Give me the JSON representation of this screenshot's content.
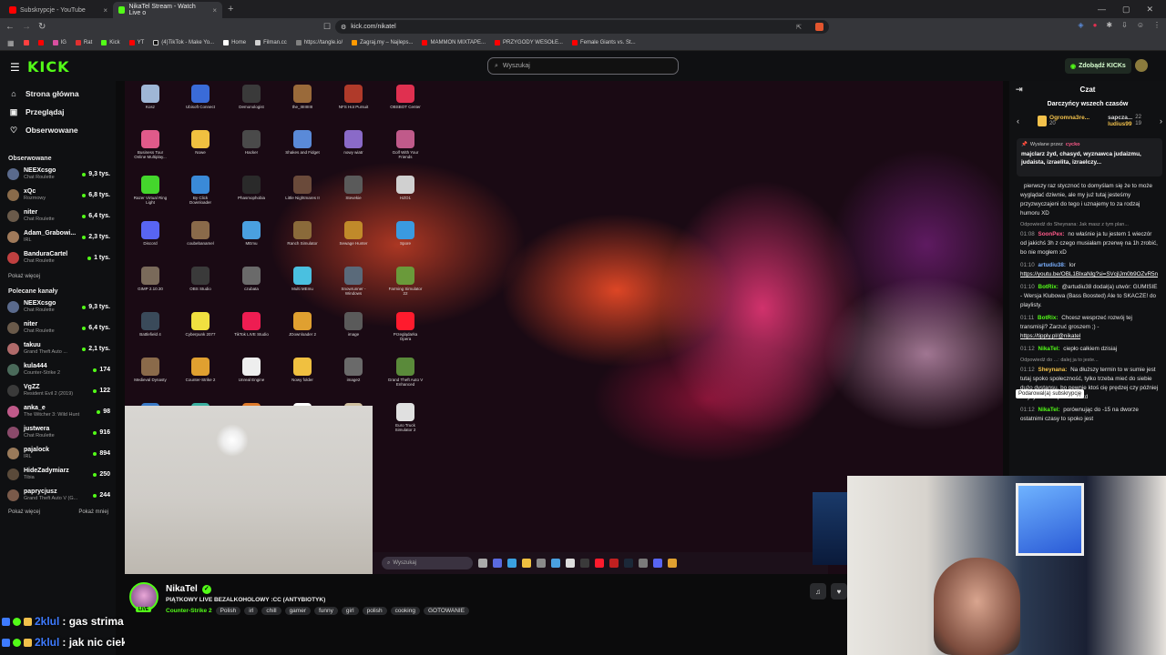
{
  "browser": {
    "tabs": [
      {
        "label": "Subskrypcje - YouTube",
        "color": "#ff0000",
        "active": false
      },
      {
        "label": "NikaTel Stream - Watch Live o",
        "color": "#53fc18",
        "active": true
      }
    ],
    "new_tab": "+",
    "url": "kick.com/nikatel",
    "bookmarks": [
      {
        "label": "",
        "color": "#ff4040"
      },
      {
        "label": "",
        "color": "#ff0000"
      },
      {
        "label": "IG",
        "color": "#d94fa0"
      },
      {
        "label": "Rat",
        "color": "#e03030"
      },
      {
        "label": "Kick",
        "color": "#53fc18"
      },
      {
        "label": "YT",
        "color": "#ff0000"
      },
      {
        "label": "(4)TikTok - Make Yo...",
        "color": "#111111"
      },
      {
        "label": "Home",
        "color": "#ffffff"
      },
      {
        "label": "Filman.cc",
        "color": "#d0d0d0"
      },
      {
        "label": "https://tangle.io/",
        "color": "#808080"
      },
      {
        "label": "Zagraj.my – Najleps...",
        "color": "#ff9900"
      },
      {
        "label": "MAMMON MIXTAPE...",
        "color": "#ff0000"
      },
      {
        "label": "PRZYGODY WESOŁE...",
        "color": "#ff0000"
      },
      {
        "label": "Female Giants vs. St...",
        "color": "#ff0000"
      }
    ]
  },
  "header": {
    "logo": "KICK",
    "search_placeholder": "Wyszukaj",
    "get_kicks": "Zdobądź KICKs"
  },
  "sidebar": {
    "nav": [
      {
        "label": "Strona główna",
        "icon": "home-icon",
        "glyph": "⌂"
      },
      {
        "label": "Przeglądaj",
        "icon": "browse-icon",
        "glyph": "▣"
      },
      {
        "label": "Obserwowane",
        "icon": "heart-icon",
        "glyph": "♡"
      }
    ],
    "followed_title": "Obserwowane",
    "followed": [
      {
        "name": "NEEXcsgo",
        "category": "Chat Roulette",
        "viewers": "9,3 tys.",
        "color": "#5a6a8c"
      },
      {
        "name": "xQc",
        "category": "Rozmowy",
        "viewers": "6,8 tys.",
        "color": "#8a6b4a"
      },
      {
        "name": "niter",
        "category": "Chat Roulette",
        "viewers": "6,4 tys.",
        "color": "#6a5a4a"
      },
      {
        "name": "Adam_Grabowi...",
        "category": "IRL",
        "viewers": "2,3 tys.",
        "color": "#a07a5a"
      },
      {
        "name": "BanduraCartel",
        "category": "Chat Roulette",
        "viewers": "1 tys.",
        "color": "#c04040"
      }
    ],
    "show_more": "Pokaż więcej",
    "recommended_title": "Polecane kanały",
    "recommended": [
      {
        "name": "NEEXcsgo",
        "category": "Chat Roulette",
        "viewers": "9,3 tys.",
        "color": "#5a6a8c"
      },
      {
        "name": "niter",
        "category": "Chat Roulette",
        "viewers": "6,4 tys.",
        "color": "#6a5a4a"
      },
      {
        "name": "takuu",
        "category": "Grand Theft Auto ...",
        "viewers": "2,1 tys.",
        "color": "#b06a6a"
      },
      {
        "name": "kula444",
        "category": "Counter-Strike 2",
        "viewers": "174",
        "color": "#4a6a5a"
      },
      {
        "name": "VgZZ",
        "category": "Resident Evil 2 (2019)",
        "viewers": "122",
        "color": "#3a3a3a"
      },
      {
        "name": "anka_e",
        "category": "The Witcher 3: Wild Hunt",
        "viewers": "98",
        "color": "#c05a8a"
      },
      {
        "name": "justwera",
        "category": "Chat Roulette",
        "viewers": "916",
        "color": "#8a4a6a"
      },
      {
        "name": "pajalock",
        "category": "IRL",
        "viewers": "894",
        "color": "#9a7a5a"
      },
      {
        "name": "HideZadymiarz",
        "category": "Tibia",
        "viewers": "250",
        "color": "#5a4a3a"
      },
      {
        "name": "paprycjusz",
        "category": "Grand Theft Auto V (G...",
        "viewers": "244",
        "color": "#7a5a4a"
      }
    ],
    "show_more2": "Pokaż więcej",
    "show_less": "Pokaż mniej"
  },
  "desktop": {
    "icons": [
      {
        "label": "Kosz",
        "color": "#9fb6d6"
      },
      {
        "label": "Ubisoft Connect",
        "color": "#3a6bd8"
      },
      {
        "label": "Demonologist",
        "color": "#3a3a3a"
      },
      {
        "label": "the_IIIIIIIIIII",
        "color": "#9a6a3a"
      },
      {
        "label": "NFS Hot Pursuit",
        "color": "#b03a2a"
      },
      {
        "label": "OBSBOT Center",
        "color": "#e03050"
      },
      {
        "label": "Business Tour Online Multiplay...",
        "color": "#e05a8a"
      },
      {
        "label": "Nowe",
        "color": "#f0c040"
      },
      {
        "label": "Hacker",
        "color": "#4a4a4a"
      },
      {
        "label": "Shakes and Fidget",
        "color": "#5a8ad8"
      },
      {
        "label": "nowy wiatr",
        "color": "#8a6ac8"
      },
      {
        "label": "Golf With Your Friends",
        "color": "#c05a8a"
      },
      {
        "label": "Razer Virtual Ring Light",
        "color": "#44d62c"
      },
      {
        "label": "By Click Downloader",
        "color": "#3a8ad8"
      },
      {
        "label": "Phasmophobia",
        "color": "#2a2a2a"
      },
      {
        "label": "Little Nightmares II",
        "color": "#6a4a3a"
      },
      {
        "label": "Stevekie",
        "color": "#5a5a5a"
      },
      {
        "label": "HZO1",
        "color": "#d0d0d0"
      },
      {
        "label": "Discord",
        "color": "#5865f2"
      },
      {
        "label": "coubebanamel",
        "color": "#8a6a4a"
      },
      {
        "label": "MEmu",
        "color": "#4aa0e0"
      },
      {
        "label": "Ranch Simulator",
        "color": "#8a6a3a"
      },
      {
        "label": "Sewage Hunter",
        "color": "#c08a2a"
      },
      {
        "label": "Spore",
        "color": "#3a9ae0"
      },
      {
        "label": "GIMP 2.10.30",
        "color": "#7a6a5a"
      },
      {
        "label": "OBS Studio",
        "color": "#3a3a3a"
      },
      {
        "label": "czubata",
        "color": "#6a6a6a"
      },
      {
        "label": "Multi MEmu",
        "color": "#4ac0e0"
      },
      {
        "label": "Snowrunner - Windows",
        "color": "#5a6a7a"
      },
      {
        "label": "Farming Simulator 22",
        "color": "#6a9a3a"
      },
      {
        "label": "Battlefield 4",
        "color": "#3a4a5a"
      },
      {
        "label": "Cyberpunk 2077",
        "color": "#f0e040"
      },
      {
        "label": "TikTok LIVE Studio",
        "color": "#ee1d52"
      },
      {
        "label": "JDownloader 2",
        "color": "#e0a030"
      },
      {
        "label": "image",
        "color": "#5a5a5a"
      },
      {
        "label": "Przeglądarka Opera",
        "color": "#ff1b2d"
      },
      {
        "label": "Medieval Dynasty",
        "color": "#8a6a4a"
      },
      {
        "label": "Counter-Strike 2",
        "color": "#e0a030"
      },
      {
        "label": "Unreal Engine",
        "color": "#eeeeee"
      },
      {
        "label": "Nowy folder",
        "color": "#f0c040"
      },
      {
        "label": "image2",
        "color": "#6a6a6a"
      },
      {
        "label": "Grand Theft Auto V Enhanced",
        "color": "#5a8a3a"
      },
      {
        "label": "Tropico 6 Frontiers of Pandora",
        "color": "#3a7ac8"
      },
      {
        "label": "Sims Kalorgen",
        "color": "#3ab0a0"
      },
      {
        "label": "Kebab Chefs! - Restaurant Si...",
        "color": "#e07a2a"
      },
      {
        "label": "MMSIS",
        "color": "#ffffff"
      },
      {
        "label": "House Flipper 2",
        "color": "#d0c0a0"
      },
      {
        "label": "Euro Truck Simulator 2",
        "color": "#e0e0e0"
      }
    ],
    "taskbar_search": "Wyszukaj"
  },
  "stream": {
    "name": "NikaTel",
    "title": "PIĄTKOWY LIVE BEZALKOHOLOWY :CC (ANTYBIOTYK)",
    "category": "Counter-Strike 2",
    "tags": [
      "Polish",
      "irl",
      "chill",
      "gamer",
      "funny",
      "girl",
      "polish",
      "cooking",
      "GOTOWANIE"
    ],
    "live": "LIVE"
  },
  "overlay_chat": [
    {
      "user": "2klul",
      "text": ": gas strima"
    },
    {
      "user": "2klul",
      "text": ": jak nic ciekawego nie ma"
    }
  ],
  "chat": {
    "title": "Czat",
    "gifters_title": "Darczyńcy wszech czasów",
    "gifters": [
      {
        "name": "Ogromna3re...",
        "count": "20"
      },
      {
        "name": "sapcza...",
        "count": "22"
      },
      {
        "name": "ludius99",
        "count": "19"
      }
    ],
    "pinned_by": "Wysłane przez",
    "pinned_user": "cycko",
    "pinned_text": "majclarz żyd, chasyd, wyznawca judaizmu, judaista, izraelita, izraelczy...",
    "messages": [
      {
        "reply": "",
        "time": "",
        "user": "",
        "color": "#ffffff",
        "text": "pierwszy raz stycznoć to domyślam się że to może wyglądać dziwnie, ale my już tutaj jesteśmy przyzwyczajeni do tego i uznajemy to za rodzaj humoru XD",
        "link": ""
      },
      {
        "reply": "Odpowiedź do Sheynana: Jak masz z tym plan...",
        "time": "01:08",
        "user": "SoonPex:",
        "color": "#ff5a8a",
        "text": "no właśnie ja tu jestem 1 wieczór od jakichś 3h z czego musiałam przerwę na 1h zrobić, bo nie mogłem xD",
        "link": ""
      },
      {
        "reply": "",
        "time": "01:10",
        "user": "artudiu38:",
        "color": "#7ab0ff",
        "text": "lor",
        "link": "https://youtu.be/OBL1BlxaNlg?si=SVcjlJm0b9OZvR5n"
      },
      {
        "reply": "",
        "time": "01:10",
        "user": "BotRix:",
        "color": "#53fc18",
        "text": "@artudiu38 dodał(a) utwór: GUMISIE - Wersja Klubowa (Bass Boosted) Ale to SKACZE! do playlisty.",
        "link": ""
      },
      {
        "reply": "",
        "time": "01:11",
        "user": "BotRix:",
        "color": "#53fc18",
        "text": "Chcesz wesprzeć rozwój tej transmisji? Zarzuć groszem ;) -",
        "link": "https://tipply.pl/@nikatel"
      },
      {
        "reply": "",
        "time": "01:12",
        "user": "NikaTel:",
        "color": "#53fc18",
        "text": "ciepło całkiem dzisiaj",
        "link": ""
      },
      {
        "reply": "Odpowiedź do ...: dalej ja to jeste...",
        "time": "01:12",
        "user": "Sheynana:",
        "color": "#f2c14b",
        "text": "Na dłuższy termin to w sumie jest tutaj spoko społeczność, tylko trzeba mieć do siebie dużo dystansu, bo pewnie ktoś cię prędzej czy później zwyzywa albo podkurwi xd",
        "link": ""
      },
      {
        "reply": "",
        "time": "01:12",
        "user": "NikaTel:",
        "color": "#53fc18",
        "text": "porównując do -15 na dworze ostatnimi czasy to spoko jest",
        "link": ""
      }
    ],
    "tooltip": "Podarowal(a) subskrypcję"
  }
}
